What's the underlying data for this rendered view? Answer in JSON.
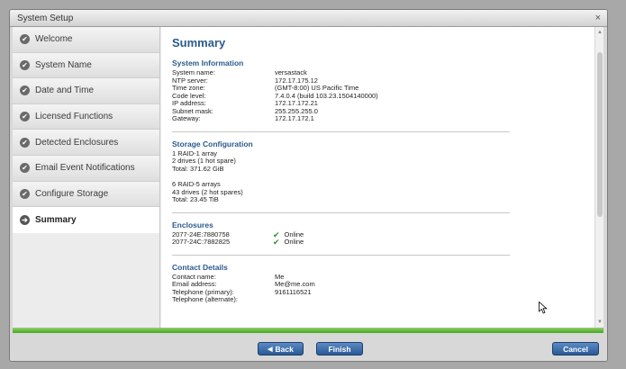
{
  "window": {
    "title": "System Setup",
    "close_glyph": "×"
  },
  "sidebar": {
    "items": [
      {
        "label": "Welcome",
        "state": "done"
      },
      {
        "label": "System Name",
        "state": "done"
      },
      {
        "label": "Date and Time",
        "state": "done"
      },
      {
        "label": "Licensed Functions",
        "state": "done"
      },
      {
        "label": "Detected Enclosures",
        "state": "done"
      },
      {
        "label": "Email Event Notifications",
        "state": "done"
      },
      {
        "label": "Configure Storage",
        "state": "done"
      },
      {
        "label": "Summary",
        "state": "active"
      }
    ]
  },
  "main": {
    "title": "Summary",
    "system_info": {
      "heading": "System Information",
      "rows": [
        {
          "label": "System name:",
          "value": "versastack"
        },
        {
          "label": "NTP server:",
          "value": "172.17.175.12"
        },
        {
          "label": "Time zone:",
          "value": "(GMT-8:00) US Pacific Time"
        },
        {
          "label": "Code level:",
          "value": "7.4.0.4 (build 103.23.1504140000)"
        },
        {
          "label": "IP address:",
          "value": "172.17.172.21"
        },
        {
          "label": "Subnet mask:",
          "value": "255.255.255.0"
        },
        {
          "label": "Gateway:",
          "value": "172.17.172.1"
        }
      ]
    },
    "storage": {
      "heading": "Storage Configuration",
      "groups": [
        [
          "1 RAID-1 array",
          "2 drives (1 hot spare)",
          "Total: 371.62 GiB"
        ],
        [
          "6 RAID-5 arrays",
          "43 drives (2 hot spares)",
          "Total: 23.45 TiB"
        ]
      ]
    },
    "enclosures": {
      "heading": "Enclosures",
      "rows": [
        {
          "id": "2077-24E:7880758",
          "status": "Online"
        },
        {
          "id": "2077-24C:7882825",
          "status": "Online"
        }
      ]
    },
    "contact": {
      "heading": "Contact Details",
      "rows": [
        {
          "label": "Contact name:",
          "value": "Me"
        },
        {
          "label": "Email address:",
          "value": "Me@me.com"
        },
        {
          "label": "Telephone (primary):",
          "value": "9161116521"
        },
        {
          "label": "Telephone (alternate):",
          "value": ""
        }
      ]
    }
  },
  "progress": {
    "fraction": 1.0
  },
  "footer": {
    "back_label": "Back",
    "finish_label": "Finish",
    "cancel_label": "Cancel"
  },
  "colors": {
    "accent": "#2a5a8e",
    "button": "#3a6aa6",
    "progress": "#5cb82f",
    "online": "#2e8b2e"
  }
}
